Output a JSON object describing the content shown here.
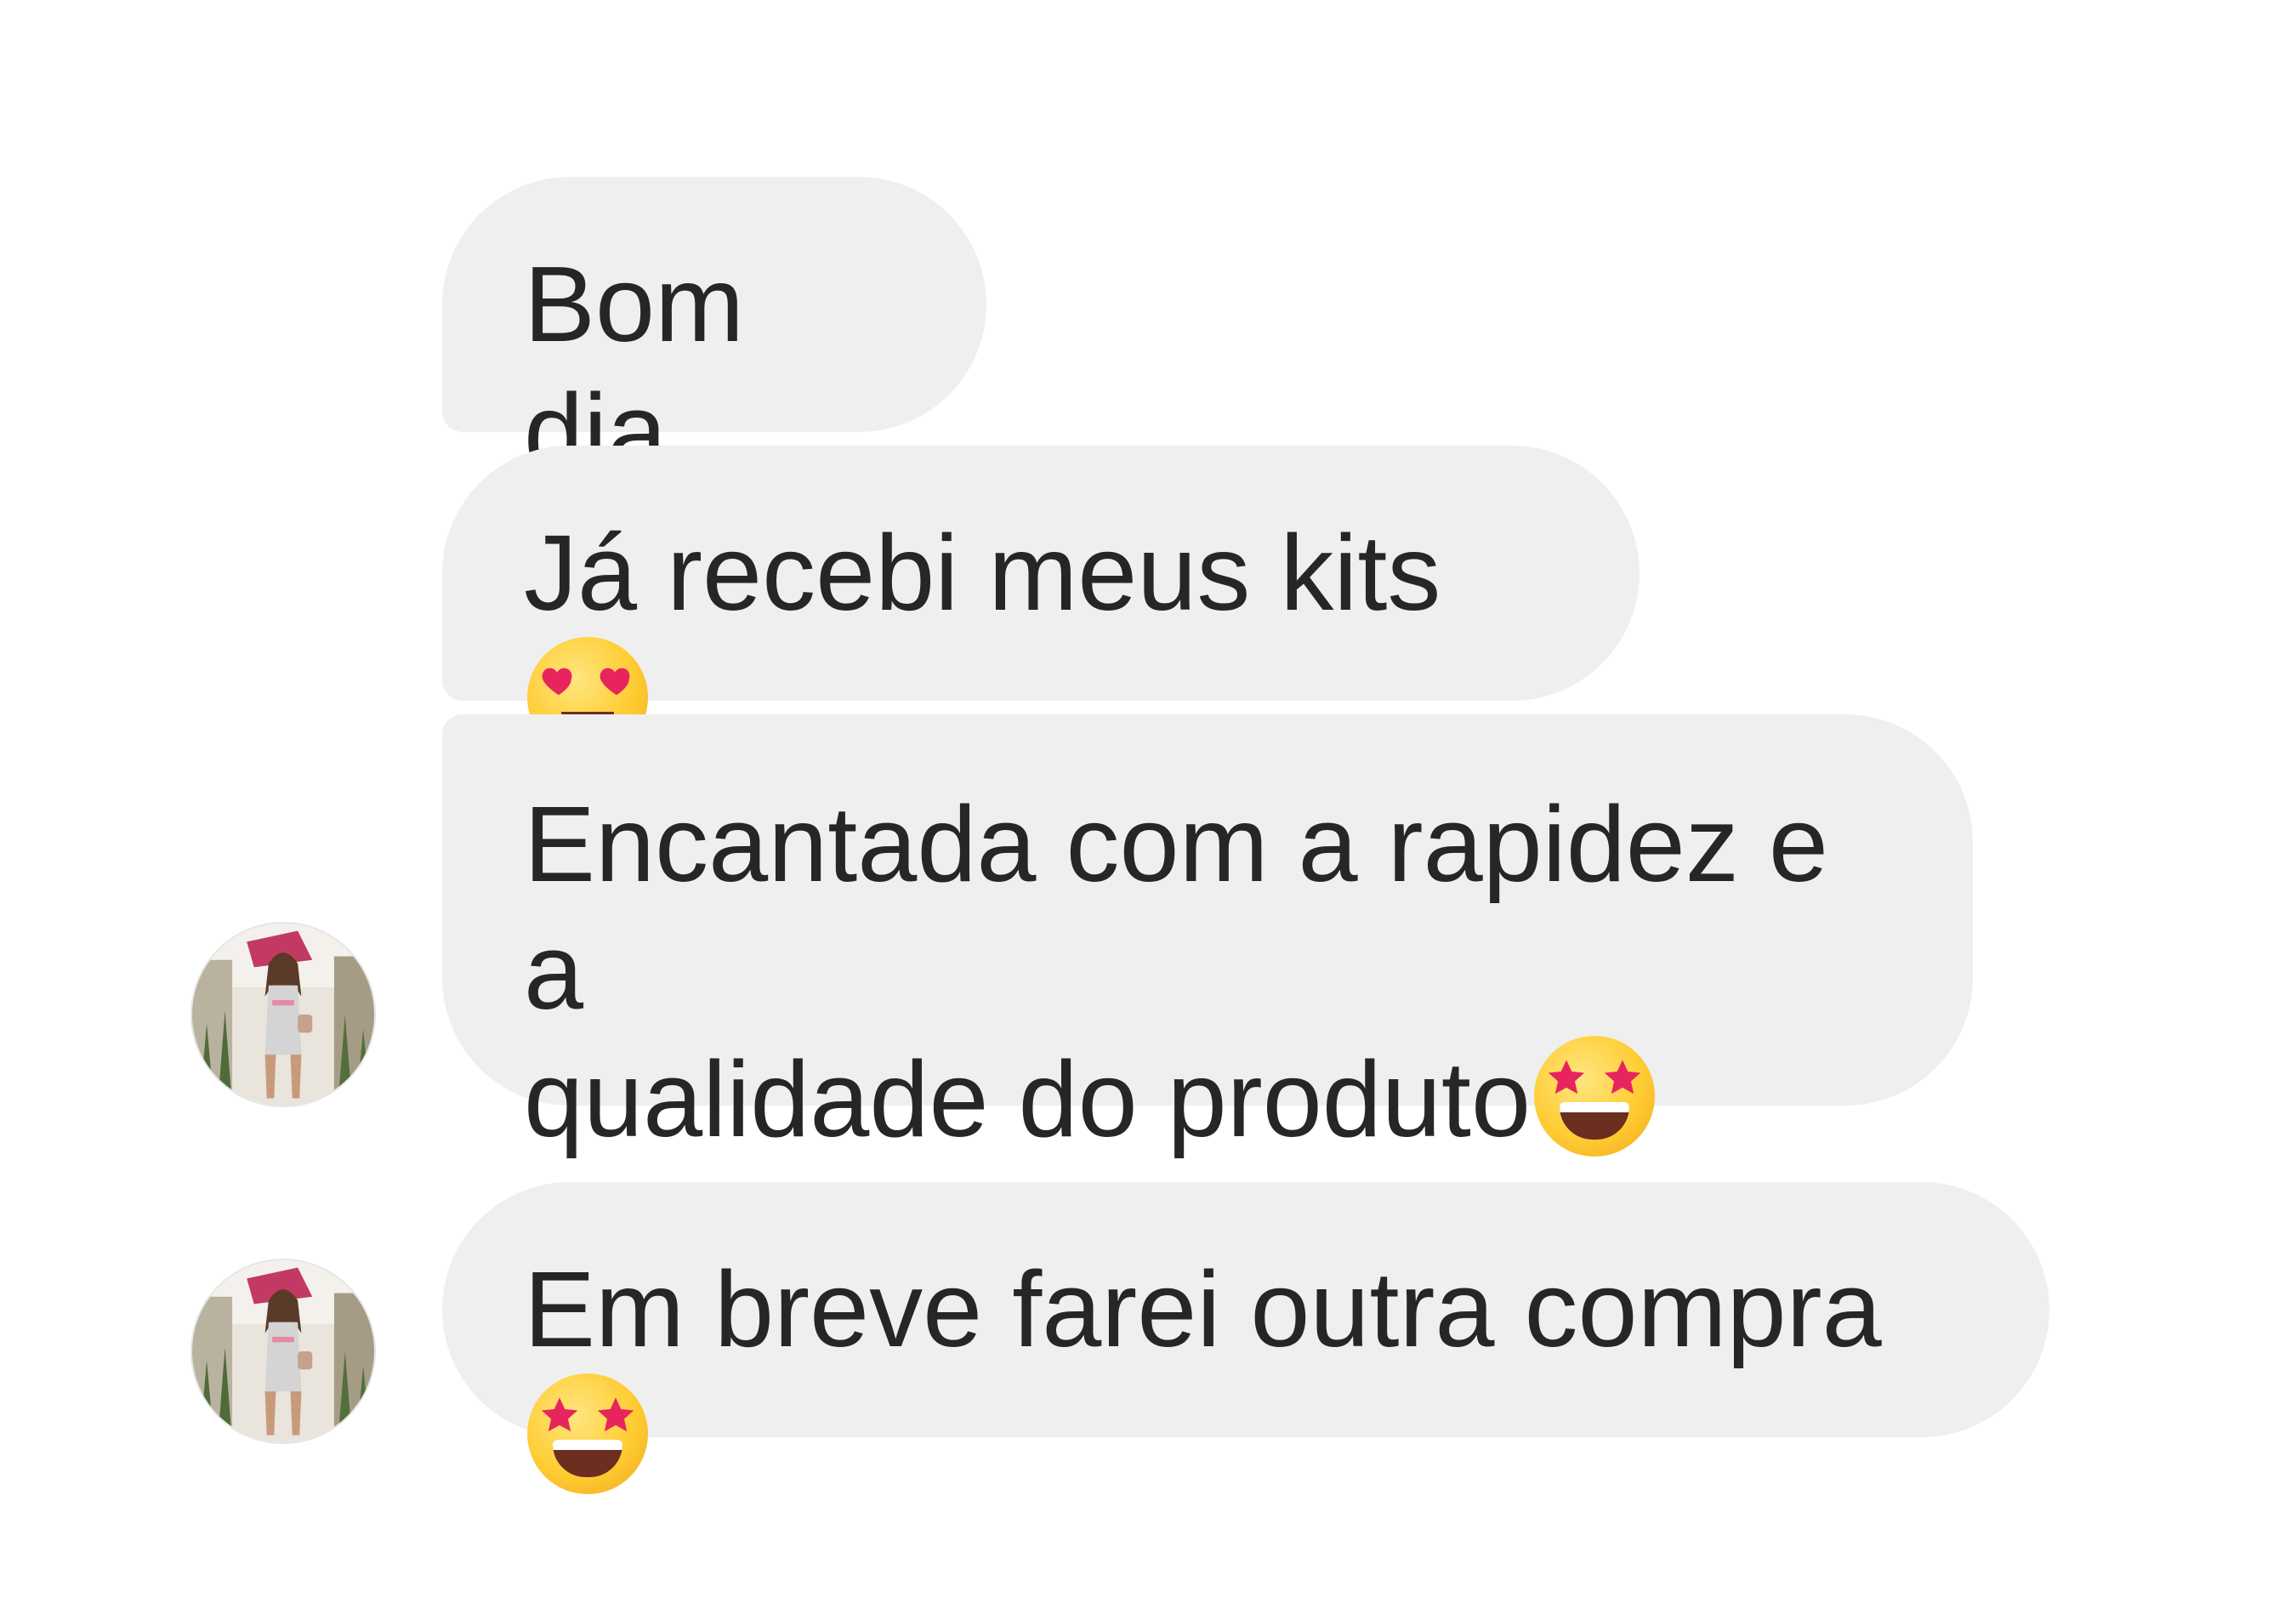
{
  "messages": [
    {
      "text": "Bom dia",
      "emoji": null
    },
    {
      "text": "Já recebi meus kits",
      "emoji": "heart-eyes-emoji"
    },
    {
      "text": "Encantada com a rapidez e a\nqualidade do produto",
      "emoji": "star-struck-emoji"
    },
    {
      "text": "Em breve farei outra compra",
      "emoji": "star-struck-emoji"
    }
  ],
  "colors": {
    "bubble_background": "#efefef",
    "text": "#262626",
    "page_background": "#ffffff"
  }
}
